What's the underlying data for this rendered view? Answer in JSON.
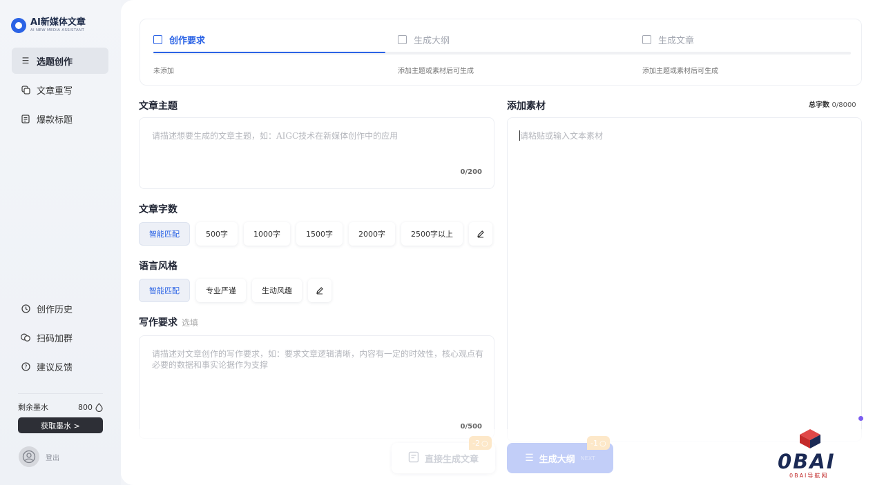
{
  "app": {
    "title": "AI新媒体文章",
    "subtitle": "AI NEW MEDIA ASSISTANT"
  },
  "sidebar": {
    "top_items": [
      {
        "label": "选题创作",
        "icon": "list-icon",
        "active": true
      },
      {
        "label": "文章重写",
        "icon": "rewrite-icon",
        "active": false
      },
      {
        "label": "爆款标题",
        "icon": "document-icon",
        "active": false
      }
    ],
    "bottom_items": [
      {
        "label": "创作历史",
        "icon": "clock-icon"
      },
      {
        "label": "扫码加群",
        "icon": "chat-group-icon"
      },
      {
        "label": "建议反馈",
        "icon": "help-circle-icon"
      }
    ],
    "ink_label": "剩余墨水",
    "ink_value": "800",
    "get_ink_label": "获取墨水 >",
    "logout_label": "登出"
  },
  "steps": {
    "items": [
      {
        "label": "创作要求",
        "status": "未添加",
        "active": true
      },
      {
        "label": "生成大纲",
        "status": "添加主题或素材后可生成",
        "active": false
      },
      {
        "label": "生成文章",
        "status": "添加主题或素材后可生成",
        "active": false
      }
    ],
    "progress": 0.333
  },
  "form": {
    "topic_label": "文章主题",
    "topic_placeholder": "请描述想要生成的文章主题，如：AIGC技术在新媒体创作中的应用",
    "topic_counter": "0/200",
    "length_label": "文章字数",
    "length_options": [
      "智能匹配",
      "500字",
      "1000字",
      "1500字",
      "2000字",
      "2500字以上"
    ],
    "style_label": "语言风格",
    "style_options": [
      "智能匹配",
      "专业严谨",
      "生动风趣"
    ],
    "req_label": "写作要求",
    "req_optional": "选填",
    "req_placeholder": "请描述对文章创作的写作要求，如：要求文章逻辑清晰，内容有一定的时效性，核心观点有必要的数据和事实论据作为支撑",
    "req_counter": "0/500",
    "material_label": "添加素材",
    "total_label": "总字数",
    "total_value": "0/8000",
    "material_placeholder": "请粘贴或输入文本素材"
  },
  "actions": {
    "direct_label": "直接生成文章",
    "direct_cost": "-2",
    "outline_label": "生成大纲",
    "outline_cost": "-1",
    "next_label": "NEXT"
  },
  "watermark": {
    "text": "0BAI",
    "sub": "0BAI导航网"
  },
  "colors": {
    "accent": "#2b63e5",
    "outline_button": "#c2cef8",
    "cost_badge": "#fde8c9"
  }
}
